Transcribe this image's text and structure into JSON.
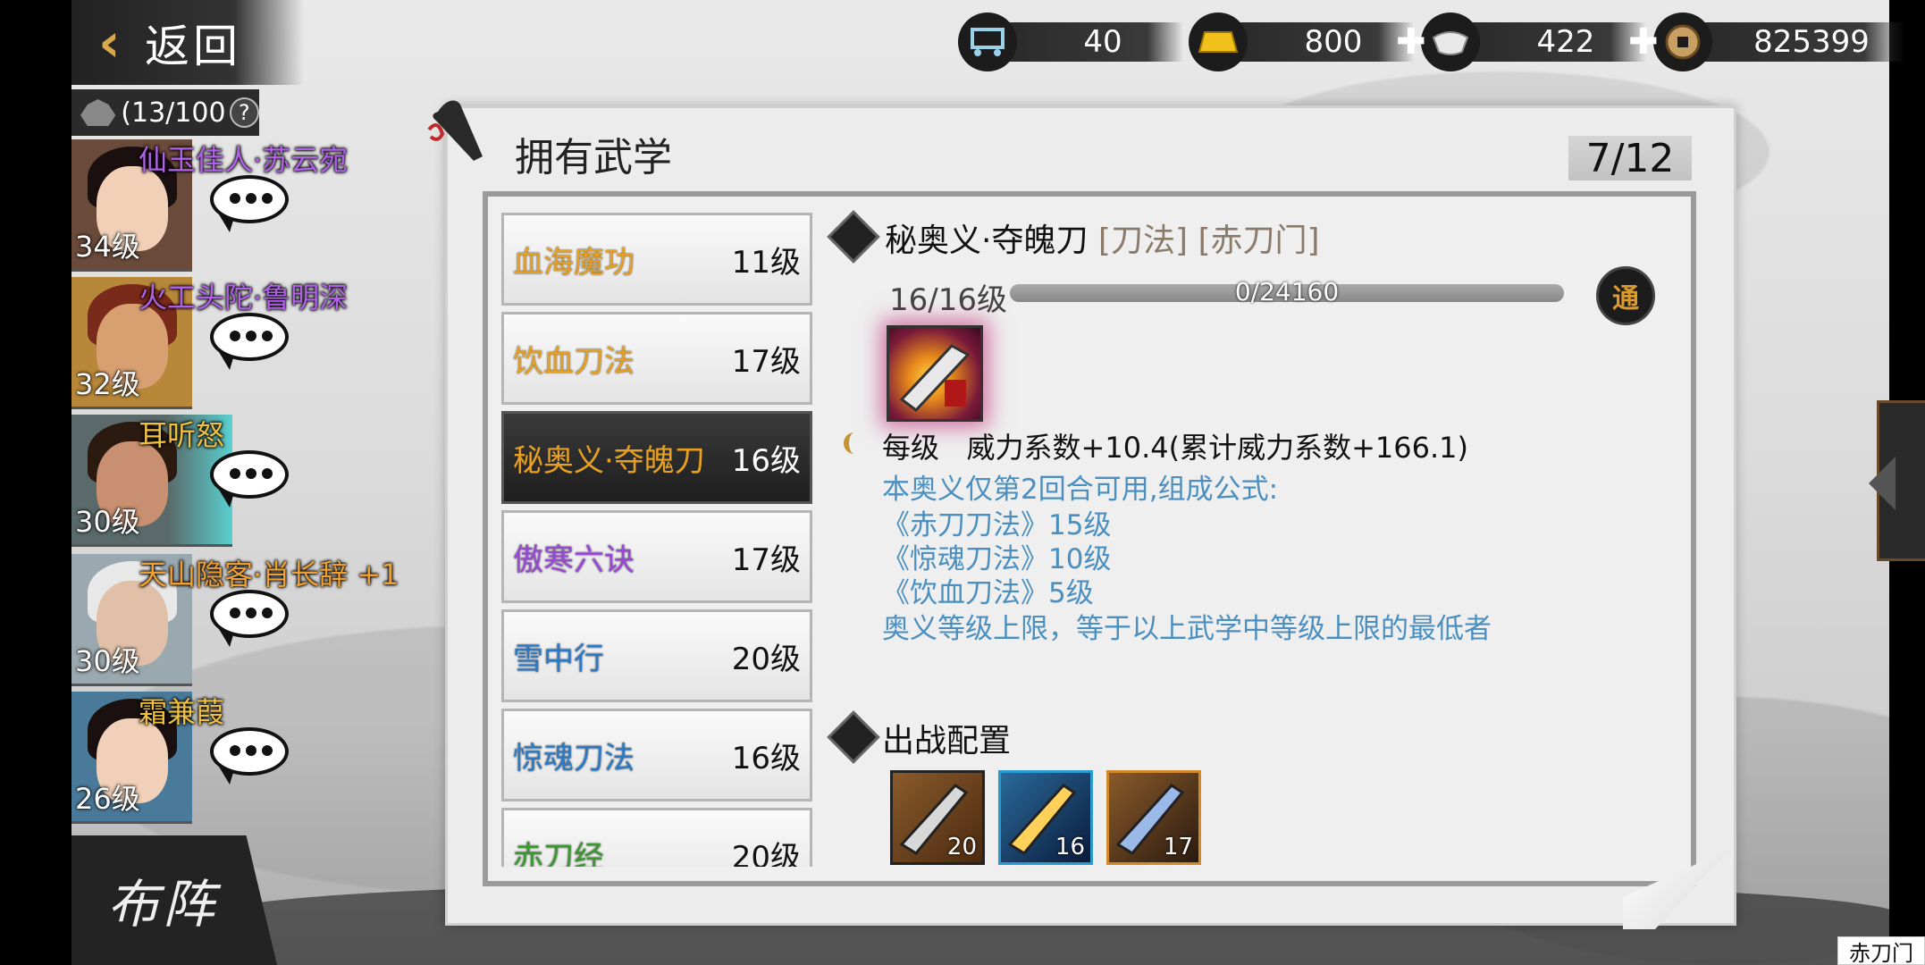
{
  "nav": {
    "back_label": "返回"
  },
  "resources": [
    {
      "icon": "cart-icon",
      "value": "40"
    },
    {
      "icon": "gold-bar-icon",
      "value": "800"
    },
    {
      "icon": "silver-ingot-icon",
      "value": "422"
    },
    {
      "icon": "copper-coin-icon",
      "value": "825399"
    }
  ],
  "roster": {
    "count": "(13/100",
    "help": "?",
    "heroes": [
      {
        "name": "仙玉佳人·苏云宛",
        "level": "34级",
        "name_color": "#b061e8"
      },
      {
        "name": "火工头陀·鲁明深",
        "level": "32级",
        "name_color": "#b061e8"
      },
      {
        "name": "耳听怒",
        "level": "30级",
        "name_color": "#f0c040"
      },
      {
        "name": "天山隐客·肖长辞 +1",
        "level": "30级",
        "name_color": "#f0a030"
      },
      {
        "name": "霜兼葭",
        "level": "26级",
        "name_color": "#f0c040"
      }
    ],
    "formation_label": "布阵"
  },
  "panel": {
    "title": "拥有武学",
    "page": "7/12"
  },
  "skills": [
    {
      "name": "血海魔功",
      "level": "11级",
      "color": "#e8a020"
    },
    {
      "name": "饮血刀法",
      "level": "17级",
      "color": "#e8a020"
    },
    {
      "name": "秘奥义·夺魄刀",
      "level": "16级",
      "color": "#e8a020"
    },
    {
      "name": "傲寒六诀",
      "level": "17级",
      "color": "#9a48d6"
    },
    {
      "name": "雪中行",
      "level": "20级",
      "color": "#2a7ac8"
    },
    {
      "name": "惊魂刀法",
      "level": "16级",
      "color": "#2a7ac8"
    },
    {
      "name": "赤刀经",
      "level": "20级",
      "color": "#3a9a30"
    }
  ],
  "detail": {
    "name": "秘奥义·夺魄刀",
    "tags": "[刀法] [赤刀门]",
    "level": "16/16级",
    "exp": "0/24160",
    "badge": "通",
    "effect_prefix": "每级",
    "effect": "威力系数+10.4(累计威力系数+166.1)",
    "desc": [
      "本奥义仅第2回合可用,组成公式:",
      "《赤刀刀法》15级",
      "《惊魂刀法》10级",
      "《饮血刀法》5级",
      "奥义等级上限，等于以上武学中等级上限的最低者"
    ],
    "loadout_title": "出战配置",
    "slots": [
      "20",
      "16",
      "17"
    ]
  },
  "tooltip": "赤刀门"
}
